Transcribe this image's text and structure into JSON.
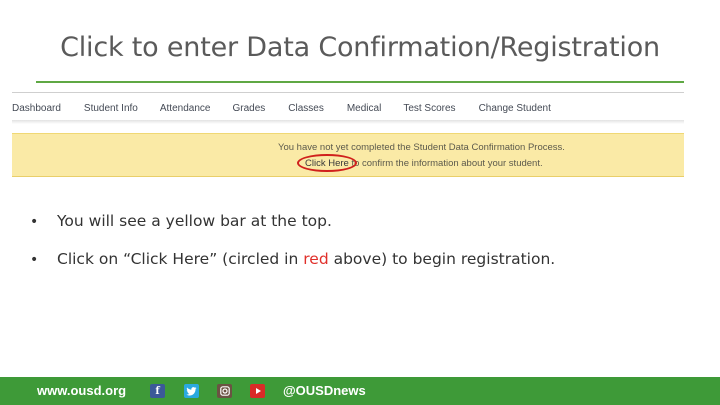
{
  "slide": {
    "title": "Click to enter Data Confirmation/Registration"
  },
  "screenshot": {
    "nav_items": [
      "Dashboard",
      "Student Info",
      "Attendance",
      "Grades",
      "Classes",
      "Medical",
      "Test Scores",
      "Change Student"
    ],
    "banner": {
      "line1": "You have not yet completed the Student Data Confirmation Process.",
      "link_text": "Click Here",
      "line2_rest": " to confirm the information about your student."
    }
  },
  "bullets": {
    "b1": "You will see a yellow bar at the top.",
    "b2_prefix": "Click on “Click Here” (circled in ",
    "b2_red": "red",
    "b2_suffix": " above) to begin registration."
  },
  "footer": {
    "site": "www.ousd.org",
    "handle": "@OUSDnews",
    "icons": [
      "facebook-icon",
      "twitter-icon",
      "instagram-icon",
      "youtube-icon"
    ]
  },
  "colors": {
    "accent_green": "#3e9a38",
    "banner_yellow": "#faeaa6",
    "highlight_red": "#d0201c"
  }
}
